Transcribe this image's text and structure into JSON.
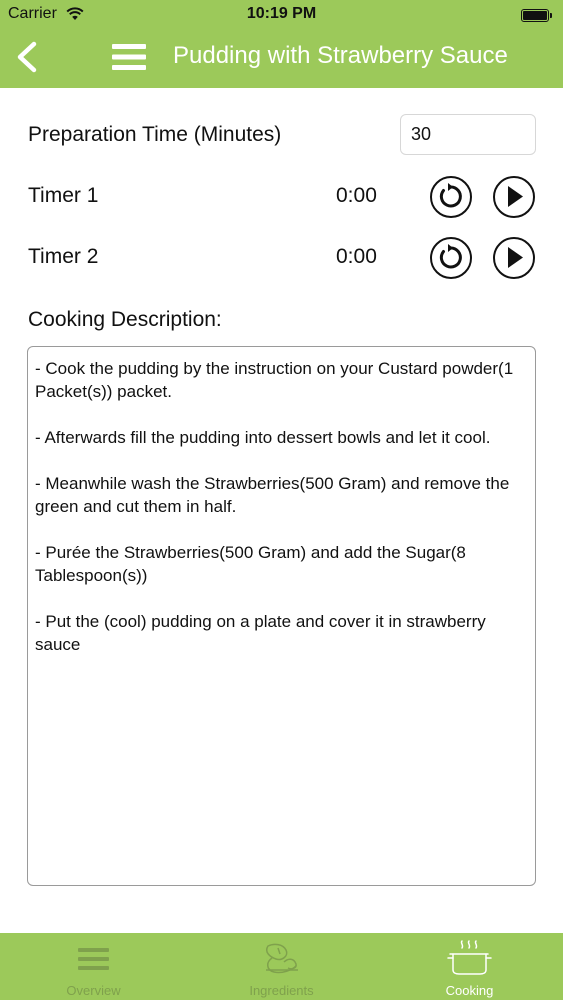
{
  "status_bar": {
    "carrier": "Carrier",
    "time": "10:19 PM"
  },
  "nav": {
    "title": "Pudding with Strawberry Sauce",
    "back_icon": "chevron-left-icon",
    "menu_icon": "hamburger-menu-icon"
  },
  "prep": {
    "label": "Preparation Time (Minutes)",
    "value": "30"
  },
  "timers": [
    {
      "label": "Timer 1",
      "value": "0:00"
    },
    {
      "label": "Timer 2",
      "value": "0:00"
    }
  ],
  "description": {
    "label": "Cooking Description:",
    "steps": [
      "- Cook the pudding by the instruction on your Custard powder(1 Packet(s)) packet.",
      "- Afterwards fill the pudding into dessert bowls and let it cool.",
      "- Meanwhile wash the Strawberries(500 Gram) and remove the green and cut them in half.",
      "- Purée the Strawberries(500 Gram) and add the Sugar(8 Tablespoon(s))",
      "- Put the (cool) pudding on a plate and cover it in strawberry sauce"
    ]
  },
  "tabs": [
    {
      "label": "Overview",
      "icon": "list-icon",
      "active": false
    },
    {
      "label": "Ingredients",
      "icon": "ingredients-icon",
      "active": false
    },
    {
      "label": "Cooking",
      "icon": "cooking-pot-icon",
      "active": true
    }
  ],
  "colors": {
    "accent": "#9cc95a",
    "tab_inactive": "#7fa14c",
    "tab_active": "#ffffff"
  }
}
